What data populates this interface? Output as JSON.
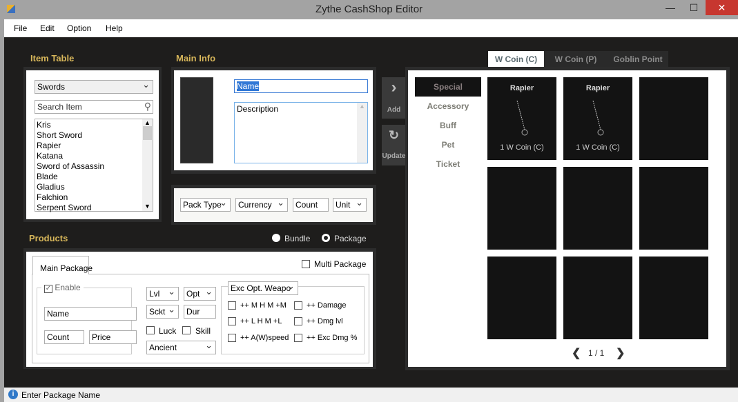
{
  "window": {
    "title": "Zythe CashShop Editor",
    "minimize": "—",
    "maximize": "☐",
    "close": "✕"
  },
  "menu": [
    "File",
    "Edit",
    "Option",
    "Help"
  ],
  "item_table": {
    "label": "Item Table",
    "category": "Swords",
    "search_placeholder": "Search Item",
    "items": [
      "Kris",
      "Short Sword",
      "Rapier",
      "Katana",
      "Sword of Assassin",
      "Blade",
      "Gladius",
      "Falchion",
      "Serpent Sword"
    ]
  },
  "main_info": {
    "label": "Main Info",
    "name": "Name",
    "description": "Description"
  },
  "pack": {
    "pack_type": "Pack Type",
    "currency": "Currency",
    "count": "Count",
    "unit": "Unit"
  },
  "actions": {
    "add": "Add",
    "update": "Update"
  },
  "products": {
    "label": "Products",
    "bundle": "Bundle",
    "package": "Package",
    "selected": "Package",
    "tab": "Main Package",
    "multi_package": "Multi Package",
    "enable": "Enable",
    "enable_checked": true,
    "name": "Name",
    "count": "Count",
    "price": "Price",
    "lvl": "Lvl",
    "opt": "Opt",
    "sckt": "Sckt",
    "dur": "Dur",
    "luck": "Luck",
    "skill": "Skill",
    "ancient": "Ancient",
    "exc_select": "Exc Opt. Weapo",
    "exc_options": [
      "++ M H M +M",
      "++ Damage",
      "++ L H M +L",
      "++ Dmg lvl",
      "++ A(W)speed",
      "++ Exc Dmg %"
    ]
  },
  "shop": {
    "tabs": [
      "W Coin (C)",
      "W Coin (P)",
      "Goblin Point"
    ],
    "active_tab": "W Coin (C)",
    "categories": [
      "Special",
      "Accessory",
      "Buff",
      "Pet",
      "Ticket"
    ],
    "active_category": "Special",
    "items": [
      {
        "name": "Rapier",
        "price": "1 W Coin (C)"
      },
      {
        "name": "Rapier",
        "price": "1 W Coin (C)"
      }
    ],
    "page": "1 / 1"
  },
  "status": {
    "text": "Enter Package Name"
  }
}
